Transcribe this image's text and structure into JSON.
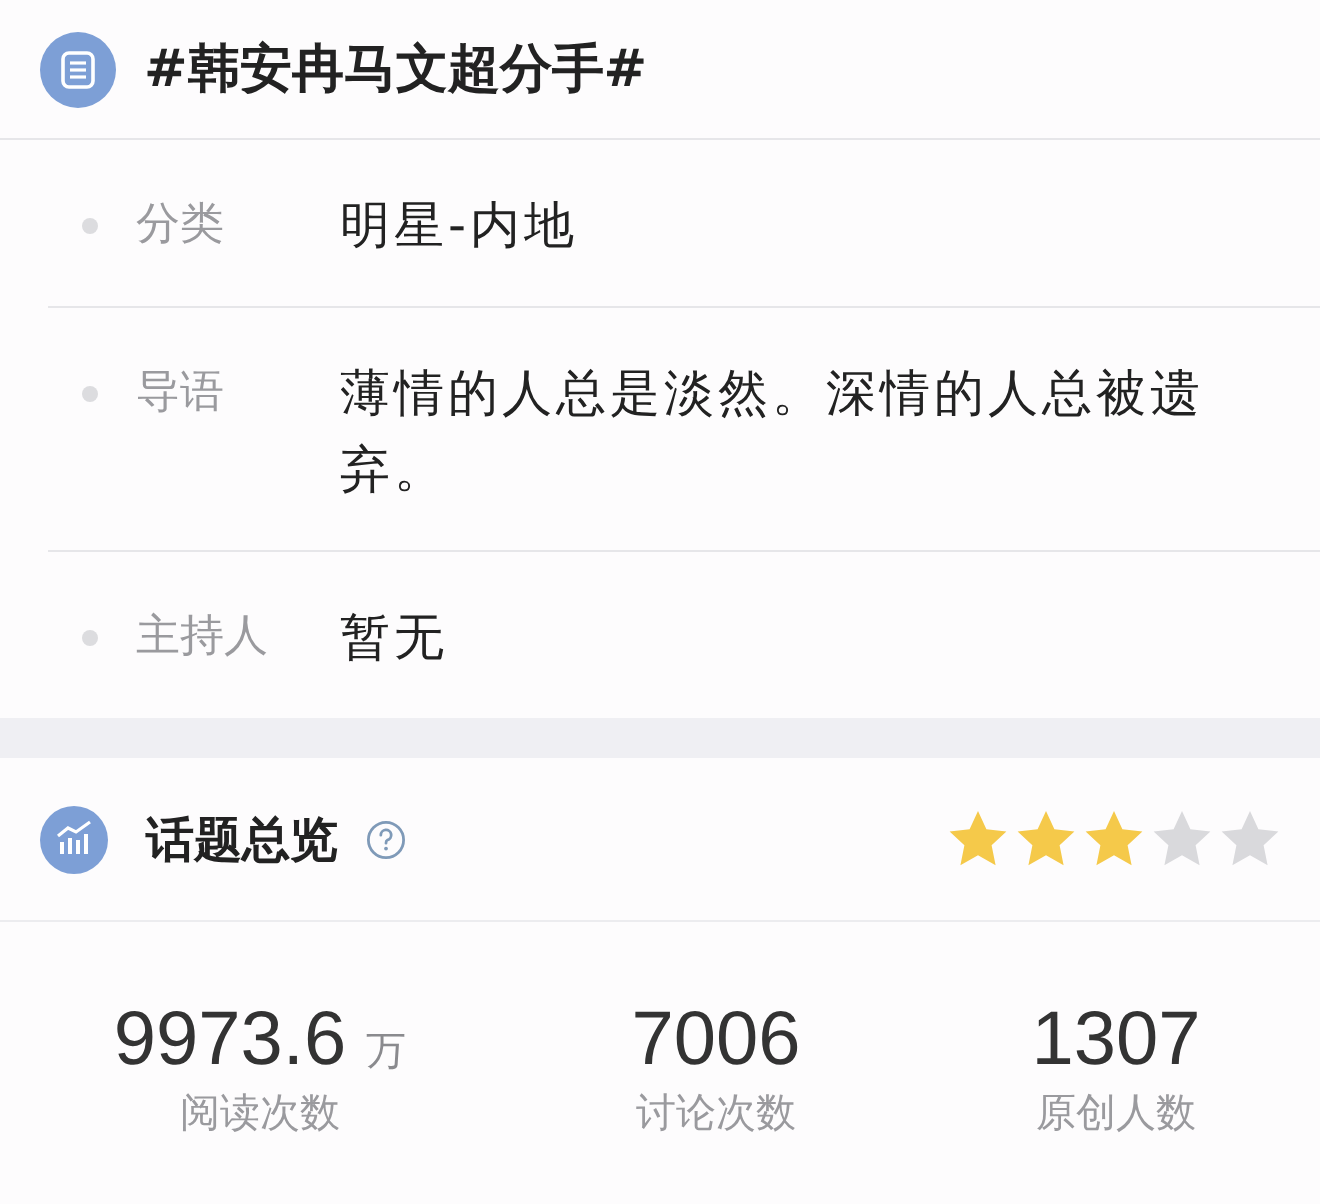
{
  "topic": {
    "title": "#韩安冉马文超分手#"
  },
  "details": [
    {
      "label": "分类",
      "value": "明星-内地"
    },
    {
      "label": "导语",
      "value": "薄情的人总是淡然。深情的人总被遗弃。"
    },
    {
      "label": "主持人",
      "value": "暂无"
    }
  ],
  "overview": {
    "title": "话题总览",
    "stars": 3,
    "stats": [
      {
        "value": "9973.6",
        "unit": "万",
        "label": "阅读次数"
      },
      {
        "value": "7006",
        "label": "讨论次数"
      },
      {
        "value": "1307",
        "label": "原创人数"
      }
    ]
  }
}
